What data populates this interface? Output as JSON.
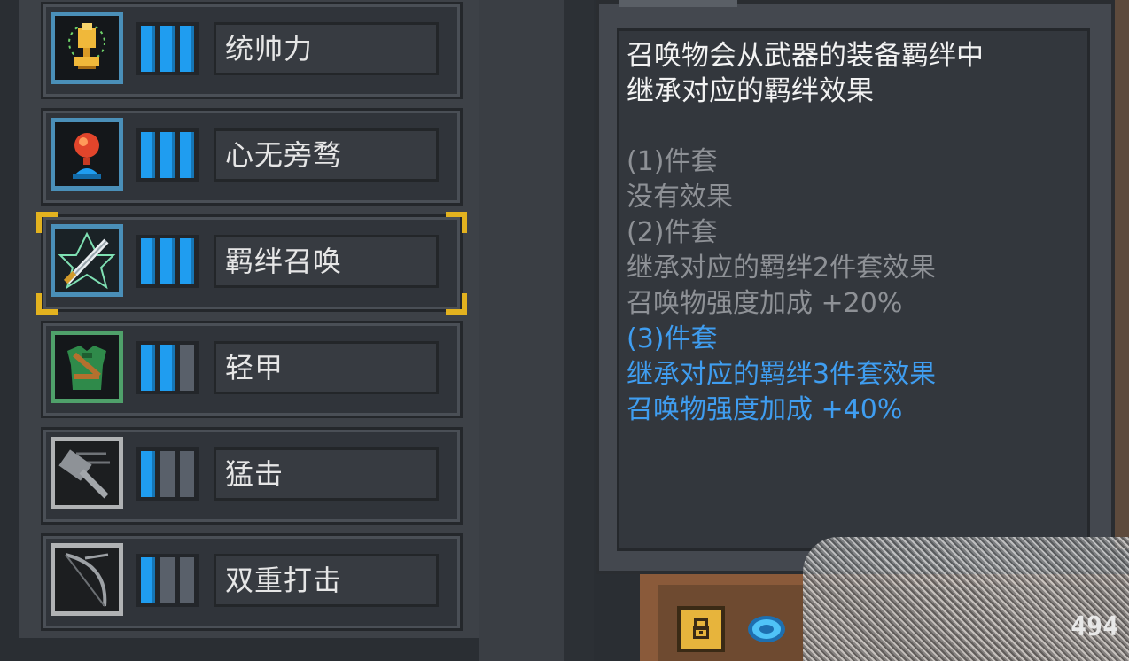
{
  "skills": [
    {
      "name": "统帅力",
      "level": 3,
      "icon": "trophy-icon",
      "frame": "blue"
    },
    {
      "name": "心无旁骛",
      "level": 3,
      "icon": "red-orb-icon",
      "frame": "blue"
    },
    {
      "name": "羁绊召唤",
      "level": 3,
      "icon": "sword-star-icon",
      "frame": "blue",
      "selected": true
    },
    {
      "name": "轻甲",
      "level": 2,
      "icon": "light-armor-icon",
      "frame": "green"
    },
    {
      "name": "猛击",
      "level": 1,
      "icon": "hammer-icon",
      "frame": "gray"
    },
    {
      "name": "双重打击",
      "level": 1,
      "icon": "bow-slash-icon",
      "frame": "gray"
    }
  ],
  "level_max": 3,
  "tooltip": {
    "description": "召唤物会从武器的装备羁绊中\n继承对应的羁绊效果",
    "tiers": [
      {
        "title": "(1)件套",
        "lines": [
          "没有效果"
        ],
        "active": false
      },
      {
        "title": "(2)件套",
        "lines": [
          "继承对应的羁绊2件套效果",
          "召唤物强度加成 +20%"
        ],
        "active": false
      },
      {
        "title": "(3)件套",
        "lines": [
          "继承对应的羁绊3件套效果",
          "召唤物强度加成 +40%"
        ],
        "active": true
      }
    ]
  },
  "footer": {
    "counter": "494"
  },
  "colors": {
    "level_on": "#1f9df0",
    "level_off": "#59606a",
    "active_text": "#3f9df0",
    "muted_text": "#8e9196",
    "selection_corner": "#e3b21f"
  }
}
